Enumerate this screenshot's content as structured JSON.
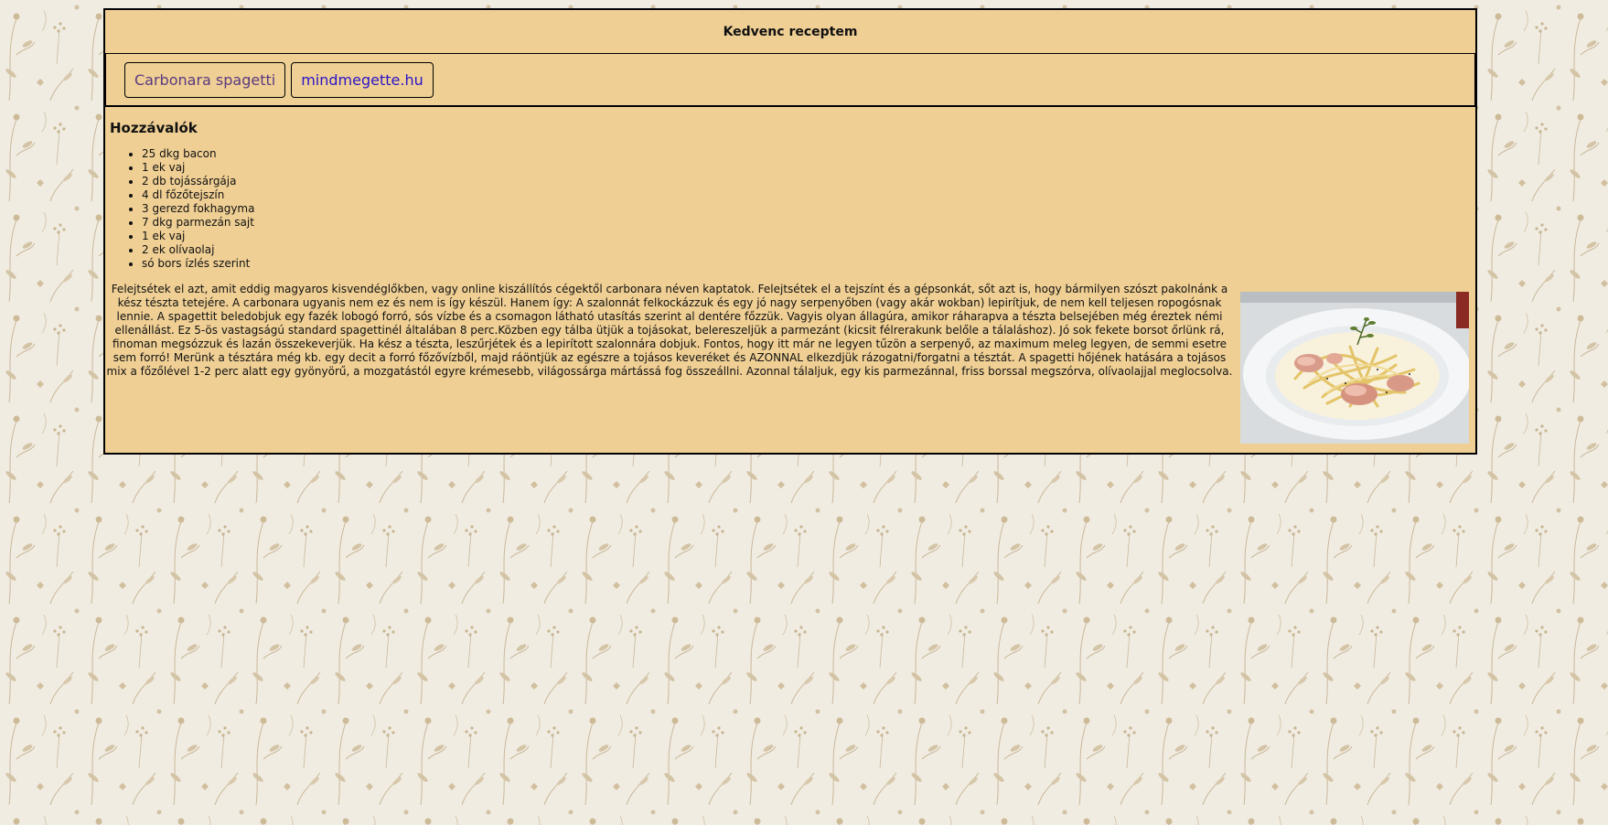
{
  "header": {
    "title": "Kedvenc receptem"
  },
  "nav": {
    "links": [
      {
        "label": "Carbonara spagetti"
      },
      {
        "label": "mindmegette.hu"
      }
    ]
  },
  "recipe": {
    "ingredients_title": "Hozzávalók",
    "ingredients": [
      "25 dkg bacon",
      "1 ek vaj",
      "2 db tojássárgája",
      "4 dl főzőtejszín",
      "3 gerezd fokhagyma",
      "7 dkg parmezán sajt",
      "1 ek vaj",
      "2 ek olívaolaj",
      "só bors ízlés szerint"
    ],
    "description": "Felejtsétek el azt, amit eddig magyaros kisvendéglőkben, vagy online kiszállítós cégektől carbonara néven kaptatok. Felejtsétek el a tejszínt és a gépsonkát, sőt azt is, hogy bármilyen szószt pakolnánk a kész tészta tetejére. A carbonara ugyanis nem ez és nem is így készül. Hanem így: A szalonnát felkockázzuk és egy jó nagy serpenyőben (vagy akár wokban) lepirítjuk, de nem kell teljesen ropogósnak lennie. A spagettit beledobjuk egy fazék lobogó forró, sós vízbe és a csomagon látható utasítás szerint al dentére főzzük. Vagyis olyan állagúra, amikor ráharapva a tészta belsejében még éreztek némi ellenállást. Ez 5-ös vastagságú standard spagettinél általában 8 perc.Közben egy tálba ütjük a tojásokat, belereszeljük a parmezánt (kicsit félrerakunk belőle a tálaláshoz). Jó sok fekete borsot őrlünk rá, finoman megsózzuk és lazán összekeverjük. Ha kész a tészta, leszűrjétek és a lepirított szalonnára dobjuk. Fontos, hogy itt már ne legyen tűzön a serpenyő, az maximum meleg legyen, de semmi esetre sem forró! Merünk a tésztára még kb. egy decit a forró főzővízből, majd ráöntjük az egészre a tojásos keveréket és AZONNAL elkezdjük rázogatni/forgatni a tésztát. A spagetti hőjének hatására a tojásos mix a főzőlével 1-2 perc alatt egy gyönyörű, a mozgatástól egyre krémesebb, világossárga mártássá fog összeállni. Azonnal tálaljuk, egy kis parmezánnal, friss borssal megszórva, olívaolajjal meglocsolva."
  },
  "colors": {
    "panel": "#efcf94",
    "border": "#000000",
    "visited_link": "#5a3a7e",
    "link": "#2a14c8"
  }
}
